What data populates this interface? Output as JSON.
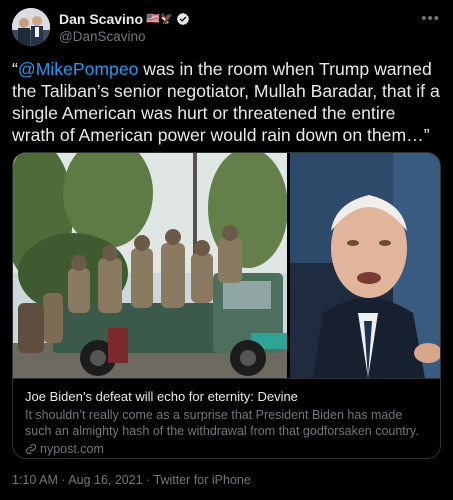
{
  "user": {
    "display_name": "Dan Scavino",
    "name_emojis": "🇺🇸🦅",
    "handle": "@DanScavino"
  },
  "tweet": {
    "quote_open": "“",
    "mention": "@MikePompeo",
    "body": " was in the room when Trump warned the Taliban’s senior negotiator, Mullah Baradar, that if a single American was hurt or threatened the entire wrath of American power would rain down on them…”"
  },
  "card": {
    "title": "Joe Biden’s defeat will echo for eternity: Devine",
    "description": "It shouldn’t really come as a surprise that President Biden has made such an almighty hash of the withdrawal from that godforsaken country.",
    "domain": "nypost.com"
  },
  "meta": {
    "timestamp": "1:10 AM · Aug 16, 2021 · Twitter for iPhone"
  },
  "colors": {
    "background": "#000000",
    "text": "#e7e9ea",
    "secondary": "#71767b",
    "accent": "#1d9bf0",
    "border": "#2f3336"
  },
  "icons": [
    "avatar",
    "verified-badge-icon",
    "more-options-icon",
    "link-icon"
  ]
}
